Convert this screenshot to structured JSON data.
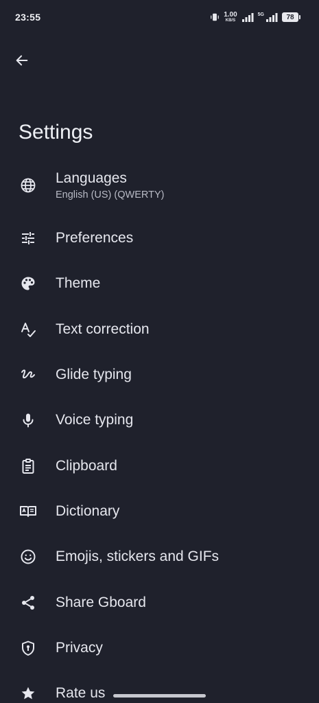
{
  "status_bar": {
    "time": "23:55",
    "net_speed_value": "1.00",
    "net_speed_unit": "KB/S",
    "signal_tag": "5G",
    "battery": "78"
  },
  "header": {
    "title": "Settings",
    "back_icon": "arrow-back-icon"
  },
  "items": [
    {
      "label": "Languages",
      "subtitle": "English (US) (QWERTY)",
      "icon": "globe-icon"
    },
    {
      "label": "Preferences",
      "icon": "tune-sliders-icon"
    },
    {
      "label": "Theme",
      "icon": "palette-icon"
    },
    {
      "label": "Text correction",
      "icon": "spellcheck-icon"
    },
    {
      "label": "Glide typing",
      "icon": "gesture-icon"
    },
    {
      "label": "Voice typing",
      "icon": "microphone-icon"
    },
    {
      "label": "Clipboard",
      "icon": "clipboard-icon"
    },
    {
      "label": "Dictionary",
      "icon": "book-icon"
    },
    {
      "label": "Emojis, stickers and GIFs",
      "icon": "smiley-icon"
    },
    {
      "label": "Share Gboard",
      "icon": "share-icon"
    },
    {
      "label": "Privacy",
      "icon": "shield-icon"
    },
    {
      "label": "Rate us",
      "icon": "star-icon"
    }
  ],
  "colors": {
    "background": "#1f212c",
    "text": "#e6e7ee",
    "subtext": "#b9bbc6"
  }
}
